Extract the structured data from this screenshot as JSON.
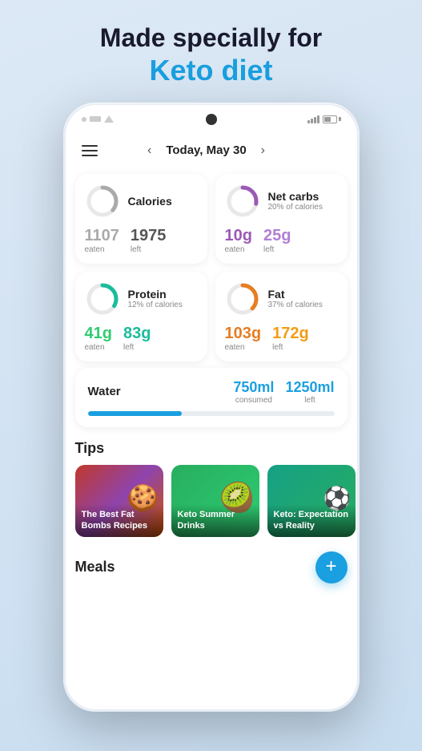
{
  "page": {
    "header_line1": "Made specially for",
    "header_line2": "Keto diet"
  },
  "nav": {
    "date_label": "Today, May 30",
    "prev_arrow": "‹",
    "next_arrow": "›"
  },
  "cards": {
    "calories": {
      "title": "Calories",
      "eaten_value": "1107",
      "eaten_label": "eaten",
      "left_value": "1975",
      "left_label": "left",
      "ring_track": "#e8e8e8",
      "ring_fill": "#aaaaaa",
      "ring_percent": 36
    },
    "net_carbs": {
      "title": "Net carbs",
      "subtitle": "20% of calories",
      "eaten_value": "10g",
      "eaten_label": "eaten",
      "left_value": "25g",
      "left_label": "left",
      "ring_track": "#e8e8e8",
      "ring_fill": "#9b59b6",
      "ring_percent": 28
    },
    "protein": {
      "title": "Protein",
      "subtitle": "12% of calories",
      "eaten_value": "41g",
      "eaten_label": "eaten",
      "left_value": "83g",
      "left_label": "left",
      "ring_track": "#e8e8e8",
      "ring_fill": "#1abc9c",
      "ring_percent": 33
    },
    "fat": {
      "title": "Fat",
      "subtitle": "37% of calories",
      "eaten_value": "103g",
      "eaten_label": "eaten",
      "left_value": "172g",
      "left_label": "left",
      "ring_track": "#e8e8e8",
      "ring_fill": "#e67e22",
      "ring_percent": 37
    }
  },
  "water": {
    "title": "Water",
    "consumed_value": "750ml",
    "consumed_label": "consumed",
    "left_value": "1250ml",
    "left_label": "left",
    "progress_percent": 38
  },
  "tips": {
    "section_title": "Tips",
    "items": [
      {
        "label": "The Best Fat Bombs Recipes",
        "bg_class": "tip-bg-1"
      },
      {
        "label": "Keto Summer Drinks",
        "bg_class": "tip-bg-2"
      },
      {
        "label": "Keto: Expectation vs Reality",
        "bg_class": "tip-bg-3"
      }
    ]
  },
  "meals": {
    "section_title": "Meals",
    "add_button_label": "+"
  }
}
